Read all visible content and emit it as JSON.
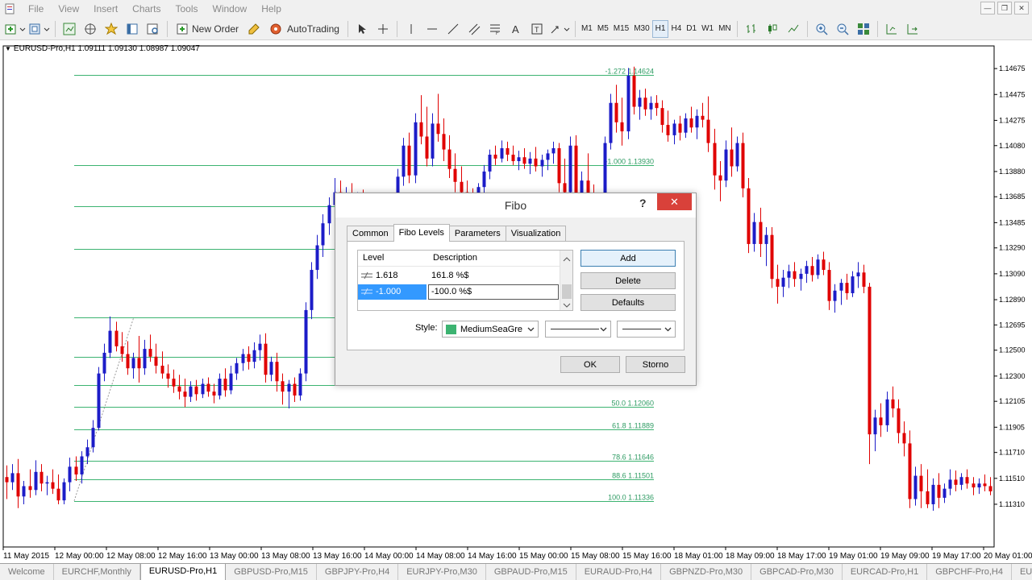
{
  "menu": [
    "File",
    "View",
    "Insert",
    "Charts",
    "Tools",
    "Window",
    "Help"
  ],
  "toolbar": {
    "new_order": "New Order",
    "autotrading": "AutoTrading"
  },
  "timeframes": [
    "M1",
    "M5",
    "M15",
    "M30",
    "H1",
    "H4",
    "D1",
    "W1",
    "MN"
  ],
  "chart": {
    "title": "EURUSD-Pro,H1  1.09111 1.09130 1.08987 1.09047"
  },
  "chart_data": {
    "type": "candlestick",
    "symbol": "EURUSD-Pro",
    "timeframe": "H1",
    "ohlc_header": [
      1.09111,
      1.0913,
      1.08987,
      1.09047
    ],
    "y_ticks": [
      1.14675,
      1.14475,
      1.14275,
      1.1408,
      1.1388,
      1.13685,
      1.13485,
      1.1329,
      1.1309,
      1.1289,
      1.12695,
      1.125,
      1.123,
      1.12105,
      1.11905,
      1.1171,
      1.1151,
      1.1131
    ],
    "x_ticks": [
      "11 May 2015",
      "12 May 00:00",
      "12 May 08:00",
      "12 May 16:00",
      "13 May 00:00",
      "13 May 08:00",
      "13 May 16:00",
      "14 May 00:00",
      "14 May 08:00",
      "14 May 16:00",
      "15 May 00:00",
      "15 May 08:00",
      "15 May 16:00",
      "18 May 01:00",
      "18 May 09:00",
      "18 May 17:00",
      "19 May 01:00",
      "19 May 09:00",
      "19 May 17:00",
      "20 May 01:00"
    ],
    "fibo_levels": [
      {
        "label": "-1.272 1.14624",
        "price": 1.14624
      },
      {
        "label": "-1.000 1.13930",
        "price": 1.1393
      },
      {
        "label": "",
        "price": 1.13611
      },
      {
        "label": "",
        "price": 1.13283
      },
      {
        "label": "",
        "price": 1.12756
      },
      {
        "label": "",
        "price": 1.12447
      },
      {
        "label": "38.2 1.12230",
        "price": 1.1223
      },
      {
        "label": "50.0 1.12060",
        "price": 1.1206
      },
      {
        "label": "61.8 1.11889",
        "price": 1.11889
      },
      {
        "label": "78.6 1.11646",
        "price": 1.11646
      },
      {
        "label": "88.6 1.11501",
        "price": 1.11501
      },
      {
        "label": "100.0 1.11336",
        "price": 1.11336
      }
    ],
    "bull_color": "#1c1cc8",
    "bear_color": "#e00000",
    "fibo_color": "#3cb371",
    "candles": [
      [
        1.1152,
        1.1161,
        1.1135,
        1.1148
      ],
      [
        1.1148,
        1.1162,
        1.1142,
        1.1155
      ],
      [
        1.1155,
        1.1166,
        1.1128,
        1.1137
      ],
      [
        1.1137,
        1.1149,
        1.1131,
        1.1145
      ],
      [
        1.1145,
        1.1158,
        1.1136,
        1.1142
      ],
      [
        1.1142,
        1.1165,
        1.1138,
        1.1156
      ],
      [
        1.1156,
        1.1162,
        1.1141,
        1.1147
      ],
      [
        1.1147,
        1.1153,
        1.1138,
        1.1148
      ],
      [
        1.1148,
        1.1158,
        1.1139,
        1.1143
      ],
      [
        1.1143,
        1.1154,
        1.1131,
        1.1134
      ],
      [
        1.1134,
        1.1151,
        1.1131,
        1.1148
      ],
      [
        1.1148,
        1.1167,
        1.1141,
        1.116
      ],
      [
        1.116,
        1.1168,
        1.1149,
        1.1154
      ],
      [
        1.1154,
        1.1172,
        1.1147,
        1.1168
      ],
      [
        1.1168,
        1.1181,
        1.1162,
        1.1175
      ],
      [
        1.1175,
        1.1196,
        1.1171,
        1.119
      ],
      [
        1.119,
        1.1237,
        1.1188,
        1.1232
      ],
      [
        1.1232,
        1.1255,
        1.1226,
        1.1248
      ],
      [
        1.1248,
        1.1276,
        1.1244,
        1.1265
      ],
      [
        1.1265,
        1.1272,
        1.1249,
        1.1253
      ],
      [
        1.1253,
        1.1264,
        1.1241,
        1.1247
      ],
      [
        1.1247,
        1.1257,
        1.1231,
        1.1236
      ],
      [
        1.1236,
        1.1248,
        1.1228,
        1.1244
      ],
      [
        1.1244,
        1.1261,
        1.1225,
        1.1236
      ],
      [
        1.1236,
        1.1258,
        1.1231,
        1.1251
      ],
      [
        1.1251,
        1.1262,
        1.1241,
        1.1245
      ],
      [
        1.1245,
        1.1255,
        1.1232,
        1.1238
      ],
      [
        1.1238,
        1.1249,
        1.1228,
        1.1232
      ],
      [
        1.1232,
        1.1239,
        1.1221,
        1.1228
      ],
      [
        1.1228,
        1.1235,
        1.1217,
        1.1222
      ],
      [
        1.1222,
        1.1231,
        1.1212,
        1.1218
      ],
      [
        1.1218,
        1.1228,
        1.1206,
        1.1214
      ],
      [
        1.1214,
        1.1226,
        1.121,
        1.1222
      ],
      [
        1.1222,
        1.1227,
        1.1211,
        1.1216
      ],
      [
        1.1216,
        1.1228,
        1.1213,
        1.1224
      ],
      [
        1.1224,
        1.1229,
        1.1214,
        1.1218
      ],
      [
        1.1218,
        1.1224,
        1.1209,
        1.1215
      ],
      [
        1.1215,
        1.1232,
        1.1212,
        1.1228
      ],
      [
        1.1228,
        1.1236,
        1.1214,
        1.1219
      ],
      [
        1.1219,
        1.1238,
        1.1216,
        1.1232
      ],
      [
        1.1232,
        1.1244,
        1.1227,
        1.124
      ],
      [
        1.124,
        1.1251,
        1.1234,
        1.1247
      ],
      [
        1.1247,
        1.1253,
        1.1235,
        1.1241
      ],
      [
        1.1241,
        1.1256,
        1.1236,
        1.125
      ],
      [
        1.125,
        1.1262,
        1.1242,
        1.1255
      ],
      [
        1.1255,
        1.1263,
        1.1225,
        1.1231
      ],
      [
        1.1231,
        1.1245,
        1.1226,
        1.1241
      ],
      [
        1.1241,
        1.1248,
        1.1218,
        1.1226
      ],
      [
        1.1226,
        1.1232,
        1.1208,
        1.1218
      ],
      [
        1.1218,
        1.1227,
        1.1205,
        1.1224
      ],
      [
        1.1224,
        1.1229,
        1.121,
        1.1215
      ],
      [
        1.1215,
        1.1236,
        1.1211,
        1.1232
      ],
      [
        1.1232,
        1.1287,
        1.1226,
        1.1281
      ],
      [
        1.1281,
        1.1318,
        1.1274,
        1.1312
      ],
      [
        1.1312,
        1.1339,
        1.1305,
        1.1331
      ],
      [
        1.1331,
        1.1355,
        1.1322,
        1.1348
      ],
      [
        1.1348,
        1.1368,
        1.1339,
        1.1362
      ],
      [
        1.1362,
        1.1383,
        1.1348,
        1.1372
      ],
      [
        1.1372,
        1.1381,
        1.1351,
        1.1359
      ],
      [
        1.1359,
        1.1376,
        1.1354,
        1.1371
      ],
      [
        1.1371,
        1.1379,
        1.1356,
        1.1363
      ],
      [
        1.1363,
        1.1372,
        1.1353,
        1.1367
      ],
      [
        1.1367,
        1.1374,
        1.1358,
        1.1363
      ],
      [
        1.1363,
        1.1369,
        1.1352,
        1.1358
      ],
      [
        1.1358,
        1.1366,
        1.1349,
        1.136
      ],
      [
        1.136,
        1.1365,
        1.1348,
        1.1354
      ],
      [
        1.1354,
        1.1362,
        1.1345,
        1.1357
      ],
      [
        1.1357,
        1.1371,
        1.1352,
        1.1368
      ],
      [
        1.1368,
        1.139,
        1.1363,
        1.1384
      ],
      [
        1.1384,
        1.1414,
        1.1377,
        1.1408
      ],
      [
        1.1408,
        1.1418,
        1.1379,
        1.1385
      ],
      [
        1.1385,
        1.1433,
        1.1379,
        1.1426
      ],
      [
        1.1426,
        1.1447,
        1.1409,
        1.1415
      ],
      [
        1.1415,
        1.1438,
        1.1392,
        1.1398
      ],
      [
        1.1398,
        1.1433,
        1.1392,
        1.1425
      ],
      [
        1.1425,
        1.1448,
        1.1411,
        1.1417
      ],
      [
        1.1417,
        1.1429,
        1.1396,
        1.1405
      ],
      [
        1.1405,
        1.1416,
        1.1383,
        1.139
      ],
      [
        1.139,
        1.1402,
        1.1372,
        1.138
      ],
      [
        1.138,
        1.1392,
        1.1364,
        1.1372
      ],
      [
        1.1372,
        1.1381,
        1.1358,
        1.1367
      ],
      [
        1.1367,
        1.1375,
        1.1356,
        1.1362
      ],
      [
        1.1362,
        1.1379,
        1.1358,
        1.1376
      ],
      [
        1.1376,
        1.1393,
        1.1371,
        1.1388
      ],
      [
        1.1388,
        1.1405,
        1.1382,
        1.1401
      ],
      [
        1.1401,
        1.1408,
        1.1393,
        1.1398
      ],
      [
        1.1398,
        1.1412,
        1.1395,
        1.1406
      ],
      [
        1.1406,
        1.1411,
        1.1396,
        1.1401
      ],
      [
        1.1401,
        1.1408,
        1.1393,
        1.1396
      ],
      [
        1.1396,
        1.1404,
        1.1389,
        1.1399
      ],
      [
        1.1399,
        1.1406,
        1.139,
        1.1394
      ],
      [
        1.1394,
        1.1403,
        1.1386,
        1.1398
      ],
      [
        1.1398,
        1.1407,
        1.1388,
        1.1392
      ],
      [
        1.1392,
        1.1401,
        1.1384,
        1.1397
      ],
      [
        1.1397,
        1.1405,
        1.1389,
        1.1402
      ],
      [
        1.1402,
        1.1411,
        1.1394,
        1.1406
      ],
      [
        1.1406,
        1.141,
        1.1372,
        1.1379
      ],
      [
        1.1379,
        1.1398,
        1.1365,
        1.1372
      ],
      [
        1.1372,
        1.1415,
        1.1367,
        1.1408
      ],
      [
        1.1408,
        1.1416,
        1.1352,
        1.136
      ],
      [
        1.136,
        1.1388,
        1.1356,
        1.1381
      ],
      [
        1.1381,
        1.1402,
        1.1354,
        1.1362
      ],
      [
        1.1362,
        1.1378,
        1.1348,
        1.1356
      ],
      [
        1.1356,
        1.1367,
        1.1322,
        1.1345
      ],
      [
        1.1345,
        1.1415,
        1.1339,
        1.141
      ],
      [
        1.141,
        1.1448,
        1.1405,
        1.1441
      ],
      [
        1.1441,
        1.1455,
        1.1418,
        1.1426
      ],
      [
        1.1426,
        1.1445,
        1.1408,
        1.1419
      ],
      [
        1.1419,
        1.1468,
        1.1413,
        1.1462
      ],
      [
        1.1462,
        1.1469,
        1.1432,
        1.1438
      ],
      [
        1.1438,
        1.1451,
        1.1428,
        1.1445
      ],
      [
        1.1445,
        1.1452,
        1.1431,
        1.1436
      ],
      [
        1.1436,
        1.1446,
        1.1428,
        1.1441
      ],
      [
        1.1441,
        1.1447,
        1.1431,
        1.1437
      ],
      [
        1.1437,
        1.1443,
        1.1418,
        1.1424
      ],
      [
        1.1424,
        1.1435,
        1.1411,
        1.1416
      ],
      [
        1.1416,
        1.1428,
        1.1409,
        1.1425
      ],
      [
        1.1425,
        1.1431,
        1.1412,
        1.1418
      ],
      [
        1.1418,
        1.1433,
        1.1414,
        1.1429
      ],
      [
        1.1429,
        1.1438,
        1.1418,
        1.1422
      ],
      [
        1.1422,
        1.1436,
        1.1413,
        1.1431
      ],
      [
        1.1431,
        1.1441,
        1.1422,
        1.1428
      ],
      [
        1.1428,
        1.1446,
        1.1403,
        1.141
      ],
      [
        1.141,
        1.1421,
        1.1374,
        1.1385
      ],
      [
        1.1385,
        1.1396,
        1.1365,
        1.1381
      ],
      [
        1.1381,
        1.1412,
        1.1376,
        1.1405
      ],
      [
        1.1405,
        1.1422,
        1.1384,
        1.1392
      ],
      [
        1.1392,
        1.1415,
        1.1388,
        1.141
      ],
      [
        1.141,
        1.1418,
        1.1368,
        1.1375
      ],
      [
        1.1375,
        1.1383,
        1.1325,
        1.1332
      ],
      [
        1.1332,
        1.1356,
        1.1326,
        1.1349
      ],
      [
        1.1349,
        1.136,
        1.1322,
        1.1332
      ],
      [
        1.1332,
        1.1345,
        1.1315,
        1.1339
      ],
      [
        1.1339,
        1.1345,
        1.1298,
        1.1305
      ],
      [
        1.1305,
        1.1316,
        1.1286,
        1.1299
      ],
      [
        1.1299,
        1.1312,
        1.1291,
        1.1306
      ],
      [
        1.1306,
        1.1316,
        1.1298,
        1.1311
      ],
      [
        1.1311,
        1.1318,
        1.1299,
        1.1305
      ],
      [
        1.1305,
        1.1313,
        1.1296,
        1.1309
      ],
      [
        1.1309,
        1.1319,
        1.1302,
        1.1315
      ],
      [
        1.1315,
        1.1322,
        1.1303,
        1.1308
      ],
      [
        1.1308,
        1.1324,
        1.1305,
        1.132
      ],
      [
        1.132,
        1.1326,
        1.1308,
        1.1312
      ],
      [
        1.1312,
        1.1318,
        1.1281,
        1.1288
      ],
      [
        1.1288,
        1.1301,
        1.1279,
        1.1296
      ],
      [
        1.1296,
        1.1305,
        1.1285,
        1.1302
      ],
      [
        1.1302,
        1.1309,
        1.1289,
        1.1294
      ],
      [
        1.1294,
        1.1311,
        1.1291,
        1.1307
      ],
      [
        1.1307,
        1.1318,
        1.1298,
        1.131
      ],
      [
        1.131,
        1.1316,
        1.1294,
        1.1299
      ],
      [
        1.1299,
        1.1302,
        1.1162,
        1.1185
      ],
      [
        1.1185,
        1.1204,
        1.1172,
        1.1198
      ],
      [
        1.1198,
        1.1209,
        1.1183,
        1.1192
      ],
      [
        1.1192,
        1.1218,
        1.1187,
        1.1212
      ],
      [
        1.1212,
        1.1222,
        1.1198,
        1.1205
      ],
      [
        1.1205,
        1.1212,
        1.1178,
        1.1186
      ],
      [
        1.1186,
        1.1195,
        1.1168,
        1.1178
      ],
      [
        1.1178,
        1.1188,
        1.1128,
        1.1135
      ],
      [
        1.1135,
        1.116,
        1.113,
        1.1153
      ],
      [
        1.1153,
        1.1162,
        1.1128,
        1.1141
      ],
      [
        1.1141,
        1.1158,
        1.1128,
        1.1131
      ],
      [
        1.1131,
        1.1151,
        1.1126,
        1.1146
      ],
      [
        1.1146,
        1.1155,
        1.1128,
        1.1136
      ],
      [
        1.1136,
        1.1147,
        1.1132,
        1.1143
      ],
      [
        1.1143,
        1.1158,
        1.1138,
        1.115
      ],
      [
        1.115,
        1.1157,
        1.1141,
        1.1146
      ],
      [
        1.1146,
        1.1155,
        1.1142,
        1.1152
      ],
      [
        1.1152,
        1.1158,
        1.1143,
        1.1147
      ],
      [
        1.1147,
        1.1152,
        1.1138,
        1.1144
      ],
      [
        1.1144,
        1.1151,
        1.1139,
        1.1147
      ],
      [
        1.1147,
        1.1154,
        1.1141,
        1.1145
      ],
      [
        1.1145,
        1.1152,
        1.1138,
        1.1141
      ]
    ]
  },
  "tabs": [
    "Welcome",
    "EURCHF,Monthly",
    "EURUSD-Pro,H1",
    "GBPUSD-Pro,M15",
    "GBPJPY-Pro,H4",
    "EURJPY-Pro,M30",
    "GBPAUD-Pro,M15",
    "EURAUD-Pro,H4",
    "GBPNZD-Pro,M30",
    "GBPCAD-Pro,M30",
    "EURCAD-Pro,H1",
    "GBPCHF-Pro,H4",
    "EURGBP"
  ],
  "dialog": {
    "title": "Fibo",
    "tabs": [
      "Common",
      "Fibo Levels",
      "Parameters",
      "Visualization"
    ],
    "columns": [
      "Level",
      "Description"
    ],
    "levels": [
      {
        "level": "1.618",
        "description": "161.8 %$"
      },
      {
        "level": "-1.000",
        "description": "-100.0 %$"
      }
    ],
    "buttons": {
      "add": "Add",
      "delete": "Delete",
      "defaults": "Defaults",
      "ok": "OK",
      "cancel": "Storno"
    },
    "style": {
      "label": "Style:",
      "color_name": "MediumSeaGre",
      "color": "#3cb371"
    }
  }
}
